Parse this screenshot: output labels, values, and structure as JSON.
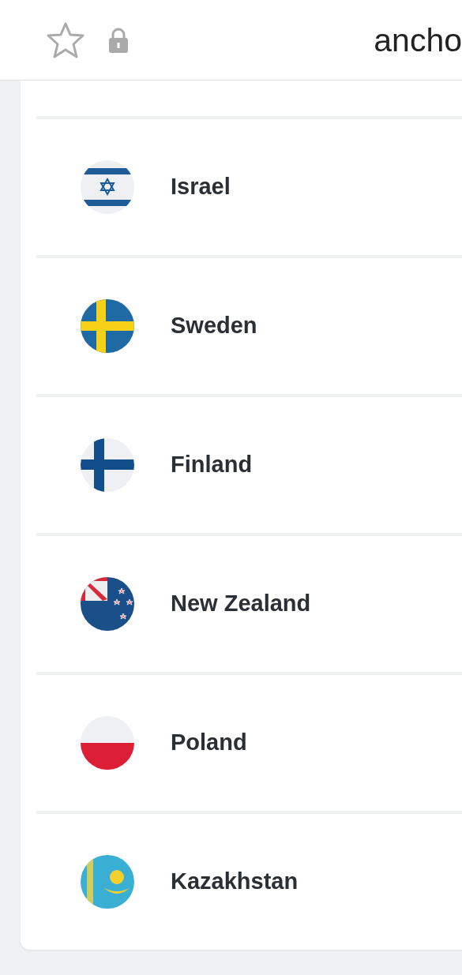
{
  "address_bar": {
    "url": "ancho"
  },
  "countries": [
    {
      "name": "Israel",
      "kind": "israel"
    },
    {
      "name": "Sweden",
      "kind": "sweden"
    },
    {
      "name": "Finland",
      "kind": "finland"
    },
    {
      "name": "New Zealand",
      "kind": "new_zealand"
    },
    {
      "name": "Poland",
      "kind": "poland"
    },
    {
      "name": "Kazakhstan",
      "kind": "kazakhstan"
    }
  ]
}
